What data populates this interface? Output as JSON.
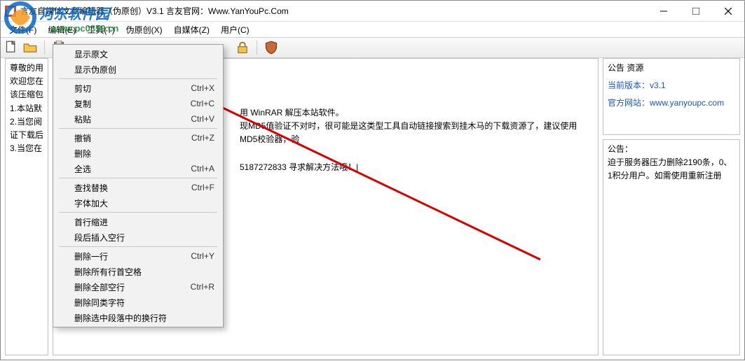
{
  "window": {
    "title": "言友自媒体文章编辑器（伪原创）V3.1 言友官网：Www.YanYouPc.Com"
  },
  "menubar": {
    "file": "文件(F)",
    "edit": "编辑(E)",
    "tool": "工具(T)",
    "pseudo": "伪原创(X)",
    "selfmedia": "自媒体(Z)",
    "user": "用户(C)"
  },
  "left_panel": {
    "l1": "尊敬的用",
    "l2": "欢迎您在",
    "l3": "",
    "l4": "该压缩包",
    "l5": "1.本站默",
    "l6": "2.当您阅",
    "l7": "",
    "l8": "证下载后",
    "l9": "3.当您在"
  },
  "center_panel": {
    "l1": "用 WinRAR 解压本站软件。",
    "l2": "现MD5值验证不对时，很可能是这类型工具自动链接搜索到挂木马的下载资源了，建议使用MD5校验器，验",
    "l3": "5187272833 寻求解决方法哦！|"
  },
  "right_top": {
    "header": "公告 资源",
    "version_label": "当前版本：",
    "version_value": "v3.1",
    "site_label": "官方网站：",
    "site_url": "www.yanyoupc.com"
  },
  "right_bot": {
    "header": "公告：",
    "line1": "迫于服务器压力删除2190条，0、",
    "line2": "1积分用户。如需使用重新注册"
  },
  "context_menu": {
    "show_orig": "显示原文",
    "show_pseudo": "显示伪原创",
    "cut": {
      "label": "剪切",
      "shortcut": "Ctrl+X"
    },
    "copy": {
      "label": "复制",
      "shortcut": "Ctrl+C"
    },
    "paste": {
      "label": "粘贴",
      "shortcut": "Ctrl+V"
    },
    "undo": {
      "label": "撤销",
      "shortcut": "Ctrl+Z"
    },
    "delete": {
      "label": "删除",
      "shortcut": ""
    },
    "select_all": {
      "label": "全选",
      "shortcut": "Ctrl+A"
    },
    "find_replace": {
      "label": "查找替换",
      "shortcut": "Ctrl+F"
    },
    "font_larger": {
      "label": "字体加大",
      "shortcut": ""
    },
    "indent_first": {
      "label": "首行缩进",
      "shortcut": ""
    },
    "insert_blank_line": {
      "label": "段后插入空行",
      "shortcut": ""
    },
    "del_line": {
      "label": "删除一行",
      "shortcut": "Ctrl+Y"
    },
    "del_leading_spaces": {
      "label": "删除所有行首空格",
      "shortcut": ""
    },
    "del_blank_lines": {
      "label": "删除全部空行",
      "shortcut": "Ctrl+R"
    },
    "del_same_chars": {
      "label": "删除同类字符",
      "shortcut": ""
    },
    "del_linebreaks_sel": {
      "label": "删除选中段落中的换行符",
      "shortcut": ""
    }
  },
  "watermark": {
    "brand": "河东软件园",
    "url": "www.pc0359.cn"
  },
  "colors": {
    "link": "#1a55c4",
    "arrow": "#d90000",
    "watermark_green": "#1f8a3b"
  }
}
